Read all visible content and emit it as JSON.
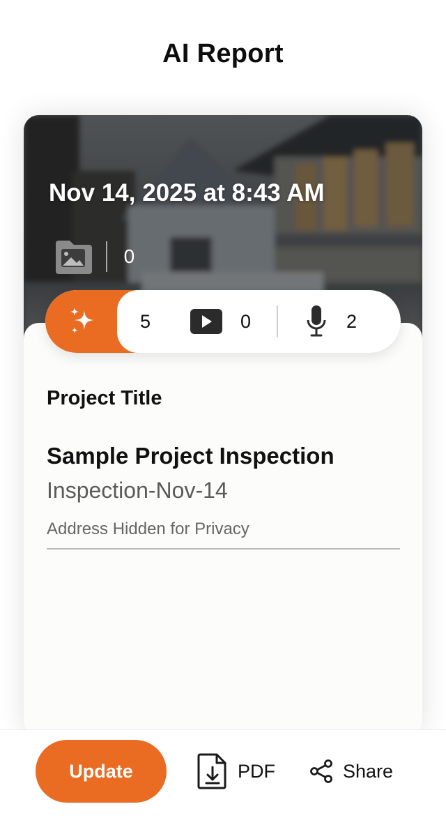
{
  "header": {
    "title": "AI Report"
  },
  "report": {
    "datetime": "Nov 14, 2025 at 8:43 AM",
    "folder_count": "5",
    "second_count": "0",
    "icons": {
      "folder": "image-folder-icon",
      "ai": "sparkles-icon",
      "video": "video-play-icon",
      "audio": "microphone-icon"
    },
    "media": {
      "images": "5",
      "videos": "0",
      "audio": "2"
    },
    "accent_color": "#ea6b22"
  },
  "project": {
    "label": "Project Title",
    "name": "Sample Project Inspection",
    "code": "Inspection-Nov-14",
    "address": "Address Hidden for Privacy"
  },
  "actions": {
    "update_label": "Update",
    "pdf_label": "PDF",
    "share_label": "Share",
    "pdf_icon": "document-download-icon",
    "share_icon": "share-icon"
  }
}
